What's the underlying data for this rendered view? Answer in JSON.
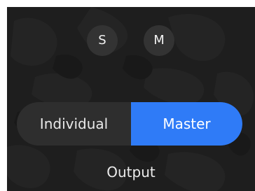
{
  "buttons": {
    "solo_label": "S",
    "mute_label": "M"
  },
  "output_toggle": {
    "options": [
      "Individual",
      "Master"
    ],
    "selected": "Master"
  },
  "section_label": "Output",
  "colors": {
    "background": "#1e1e1e",
    "toggle_track": "#2e2e2e",
    "accent": "#2f7bf7",
    "round_button": "#333333",
    "text": "#ececec"
  }
}
